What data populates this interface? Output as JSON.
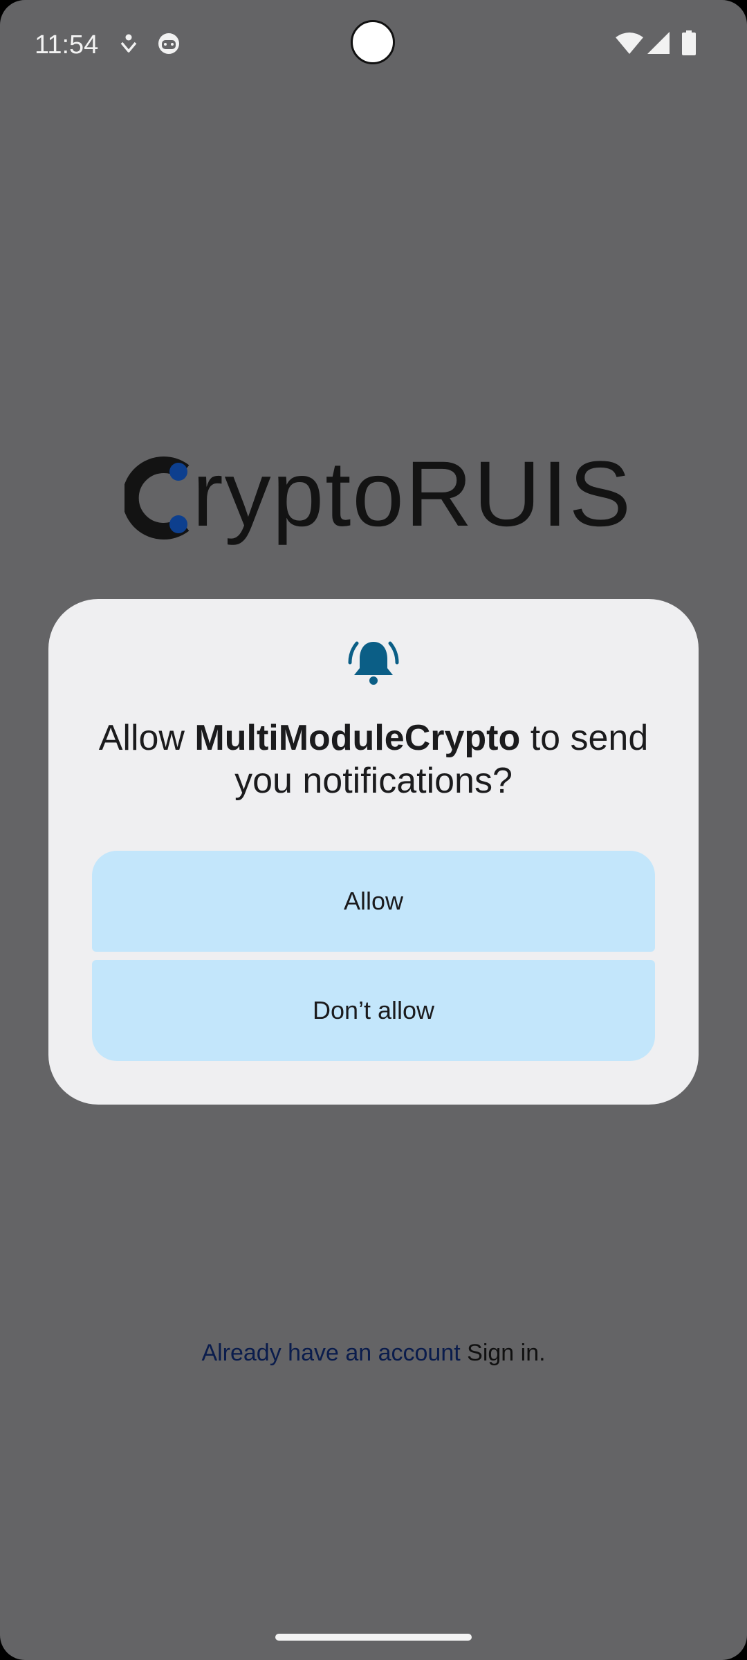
{
  "status_bar": {
    "time": "11:54",
    "left_icons": [
      "accessibility-icon",
      "face-icon"
    ],
    "right_icons": [
      "wifi-icon",
      "cell-signal-icon",
      "battery-icon"
    ]
  },
  "logo": {
    "text": "ryptoRUIS",
    "full_text": "CryptoRUIS",
    "colors": {
      "text": "#131313",
      "accent": "#0d3f8e"
    }
  },
  "dialog": {
    "icon": "bell-icon",
    "title_prefix": "Allow ",
    "app_name": "MultiModuleCrypto",
    "title_suffix": " to send you notifications?",
    "allow_label": "Allow",
    "deny_label": "Don’t allow",
    "colors": {
      "background": "#efeff1",
      "button": "#c3e6fb",
      "icon": "#0b5e86"
    }
  },
  "footer": {
    "prompt": "Already have an account",
    "link": "Sign in."
  }
}
